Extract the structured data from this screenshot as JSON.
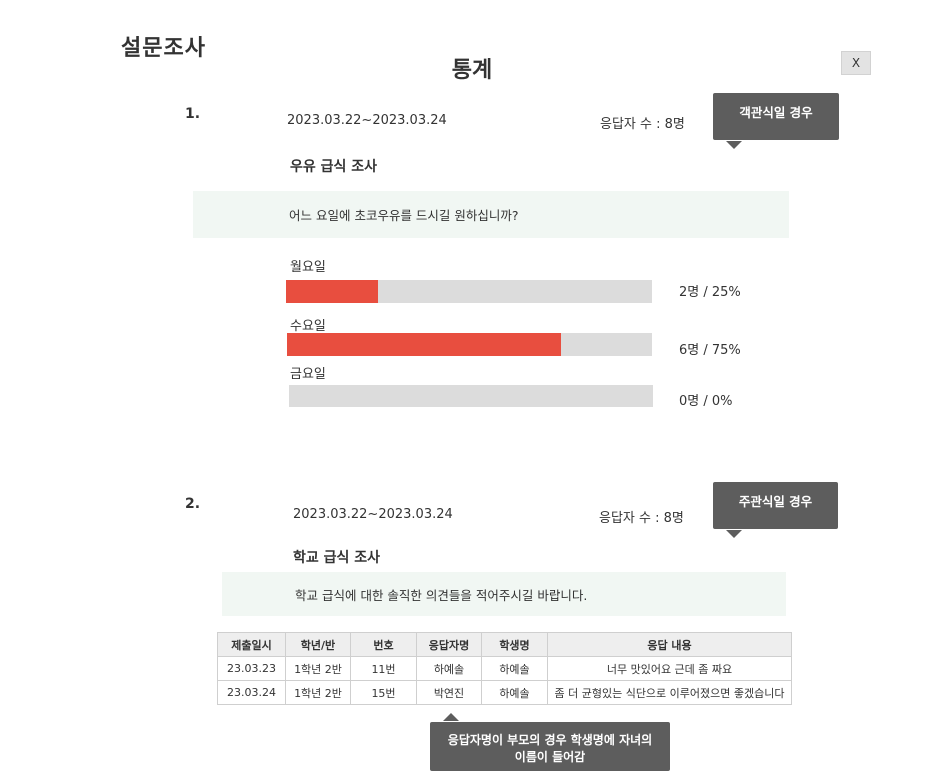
{
  "header": {
    "app_title": "설문조사",
    "page_title": "통계",
    "close_label": "X"
  },
  "questions": [
    {
      "number": "1.",
      "period": "2023.03.22~2023.03.24",
      "respondent_count": "응답자 수 : 8명",
      "title": "우유 급식 조사",
      "prompt": "어느 요일에 초코우유를 드시길 원하십니까?",
      "tooltip": "객관식일 경우",
      "options": [
        {
          "label": "월요일",
          "stat": "2명 / 25%",
          "fraction": 0.25
        },
        {
          "label": "수요일",
          "stat": "6명 / 75%",
          "fraction": 0.75
        },
        {
          "label": "금요일",
          "stat": "0명 / 0%",
          "fraction": 0
        }
      ]
    },
    {
      "number": "2.",
      "period": "2023.03.22~2023.03.24",
      "respondent_count": "응답자 수 : 8명",
      "title": "학교 급식 조사",
      "prompt": "학교 급식에 대한 솔직한 의견들을 적어주시길 바랍니다.",
      "tooltip": "주관식일 경우",
      "table": {
        "headers": [
          "제출일시",
          "학년/반",
          "번호",
          "응답자명",
          "학생명",
          "응답 내용"
        ],
        "rows": [
          [
            "23.03.23",
            "1학년 2반",
            "11번",
            "하예솔",
            "하예솔",
            "너무 맛있어요 근데 좀 짜요"
          ],
          [
            "23.03.24",
            "1학년 2반",
            "15번",
            "박연진",
            "하예솔",
            "좀 더 균형있는 식단으로 이루어졌으면 좋겠습니다"
          ]
        ]
      },
      "note_line1": "응답자명이 부모의 경우 학생명에 자녀의",
      "note_line2": "이름이 들어감"
    }
  ],
  "colors": {
    "bar_fill": "#e84e3f",
    "bar_track": "#dcdcdc",
    "prompt_bg": "#f1f7f3",
    "tooltip_bg": "#5d5d5d"
  }
}
